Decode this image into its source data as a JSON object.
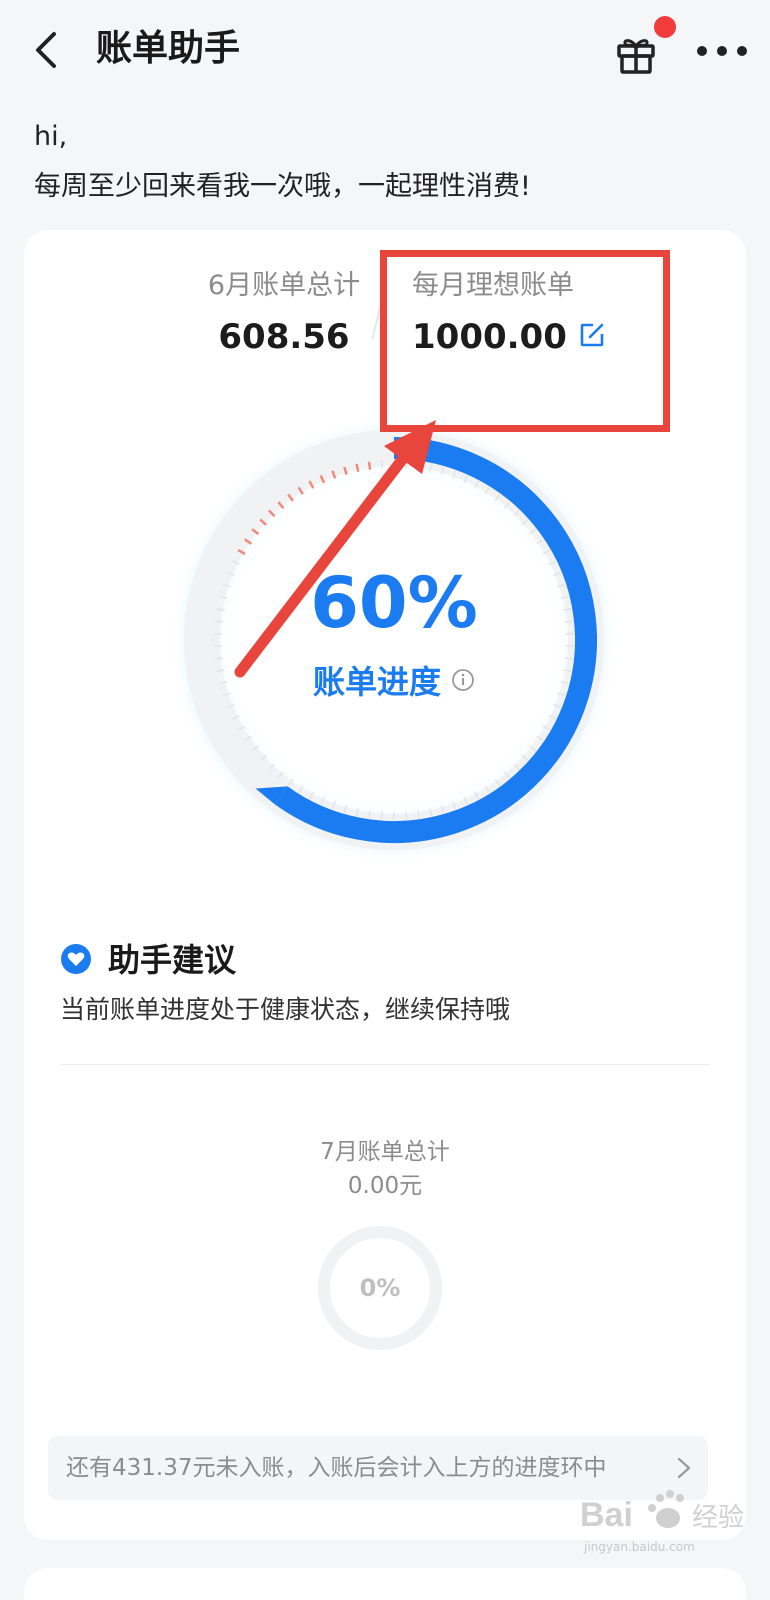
{
  "header": {
    "title": "账单助手"
  },
  "greeting": {
    "line1": "hi,",
    "line2": "每周至少回来看我一次哦，一起理性消费!"
  },
  "summary": {
    "month_total_label": "6月账单总计",
    "month_total_value": "608.56",
    "ideal_label": "每月理想账单",
    "ideal_value": "1000.00"
  },
  "progress": {
    "percent_text": "60%",
    "fraction": 0.6,
    "label": "账单进度"
  },
  "advice": {
    "title": "助手建议",
    "text": "当前账单进度处于健康状态，继续保持哦"
  },
  "next_month": {
    "label": "7月账单总计",
    "value": "0.00元",
    "percent_text": "0%"
  },
  "notice": {
    "text": "还有431.37元未入账，入账后会计入上方的进度环中"
  },
  "watermark": {
    "text": "Bai du 经验",
    "url_text": "jingyan.baidu.com"
  },
  "colors": {
    "accent": "#1a7cf0",
    "annotation": "#e8453c",
    "badge": "#f23c3c"
  }
}
